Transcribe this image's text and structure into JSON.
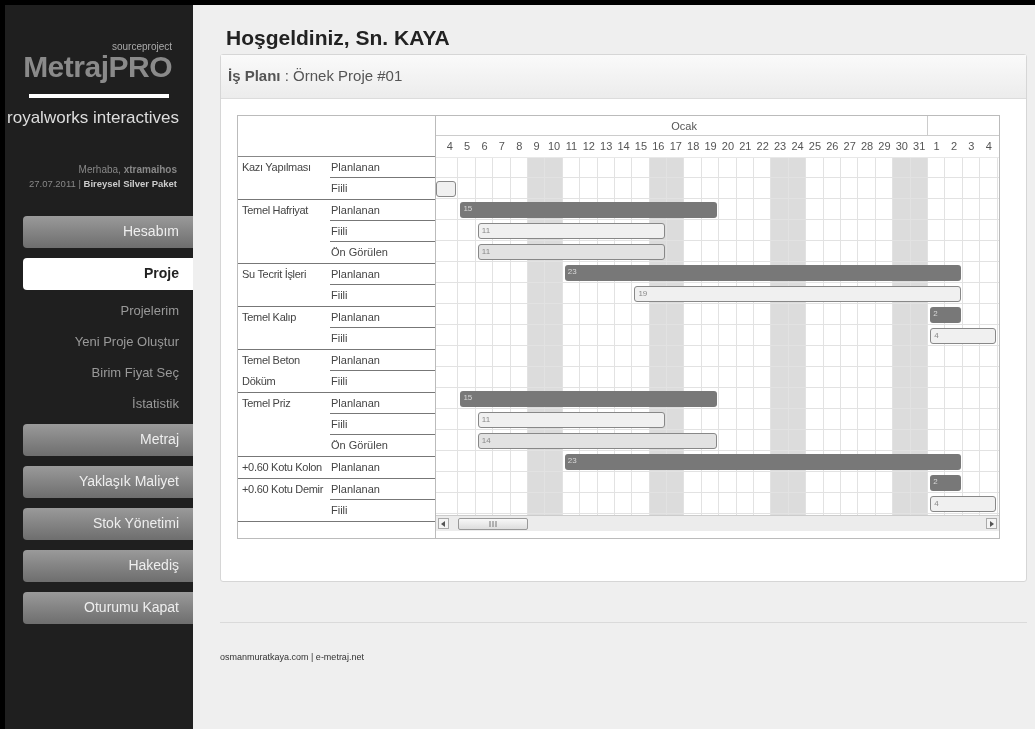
{
  "sidebar": {
    "logo_top": "sourceproject",
    "logo": "MetrajPRO",
    "tagline": "royalworks interactives",
    "greeting": "Merhaba, **xtramaihos**",
    "account": "27.07.2011 | **Bireysel Silver Paket**",
    "items": [
      {
        "label": "Hesabım",
        "kind": "section",
        "selected": false
      },
      {
        "label": "Proje",
        "kind": "section",
        "selected": true
      },
      {
        "label": "Projelerim",
        "kind": "link",
        "selected": false
      },
      {
        "label": "Yeni Proje Oluştur",
        "kind": "link",
        "selected": false
      },
      {
        "label": "Birim Fiyat Seç",
        "kind": "link",
        "selected": false
      },
      {
        "label": "İstatistik",
        "kind": "link",
        "selected": false
      },
      {
        "label": "Metraj",
        "kind": "section",
        "selected": false
      },
      {
        "label": "Yaklaşık Maliyet",
        "kind": "section",
        "selected": false
      },
      {
        "label": "Stok Yönetimi",
        "kind": "section",
        "selected": false
      },
      {
        "label": "Hakediş",
        "kind": "section",
        "selected": false
      },
      {
        "label": "Oturumu Kapat",
        "kind": "section",
        "selected": false
      }
    ]
  },
  "page_title": "Hoşgeldiniz, Sn. KAYA",
  "card": {
    "title": "**İş Planı** : Örnek Proje #01",
    "gantt": {
      "months": [
        {
          "label": "Ocak",
          "days": [
            {
              "label": "4",
              "weekend": false
            },
            {
              "label": "5",
              "weekend": false
            },
            {
              "label": "6",
              "weekend": false
            },
            {
              "label": "7",
              "weekend": false
            },
            {
              "label": "8",
              "weekend": false
            },
            {
              "label": "9",
              "weekend": true
            },
            {
              "label": "10",
              "weekend": true
            },
            {
              "label": "11",
              "weekend": false
            },
            {
              "label": "12",
              "weekend": false
            },
            {
              "label": "13",
              "weekend": false
            },
            {
              "label": "14",
              "weekend": false
            },
            {
              "label": "15",
              "weekend": false
            },
            {
              "label": "16",
              "weekend": true
            },
            {
              "label": "17",
              "weekend": true
            },
            {
              "label": "18",
              "weekend": false
            },
            {
              "label": "19",
              "weekend": false
            },
            {
              "label": "20",
              "weekend": false
            },
            {
              "label": "21",
              "weekend": false
            },
            {
              "label": "22",
              "weekend": false
            },
            {
              "label": "23",
              "weekend": true
            },
            {
              "label": "24",
              "weekend": true
            },
            {
              "label": "25",
              "weekend": false
            },
            {
              "label": "26",
              "weekend": false
            },
            {
              "label": "27",
              "weekend": false
            },
            {
              "label": "28",
              "weekend": false
            },
            {
              "label": "29",
              "weekend": false
            },
            {
              "label": "30",
              "weekend": true
            },
            {
              "label": "31",
              "weekend": true
            }
          ]
        },
        {
          "days": [
            {
              "label": "1",
              "weekend": false
            },
            {
              "label": "2",
              "weekend": false
            },
            {
              "label": "3",
              "weekend": false
            },
            {
              "label": "4",
              "weekend": false
            }
          ]
        }
      ],
      "tasks": [
        {
          "name": "Kazı Yapılması",
          "rows": [
            {
              "type": "Planlanan"
            },
            {
              "type": "Fiili",
              "bar": {
                "kind": "actual"
              }
            }
          ]
        },
        {
          "name": "Temel Hafriyat",
          "rows": [
            {
              "type": "Planlanan",
              "bar": {
                "kind": "planned",
                "label": "15"
              }
            },
            {
              "type": "Fiili",
              "bar": {
                "kind": "actual",
                "label": "11"
              }
            },
            {
              "type": "Ön Görülen",
              "bar": {
                "kind": "forecast",
                "label": "11"
              }
            }
          ]
        },
        {
          "name": "Su Tecrit İşleri",
          "rows": [
            {
              "type": "Planlanan",
              "bar": {
                "kind": "planned",
                "label": "23"
              }
            },
            {
              "type": "Fiili",
              "bar": {
                "kind": "actual",
                "label": "19"
              }
            }
          ]
        },
        {
          "name": "Temel Kalıp",
          "rows": [
            {
              "type": "Planlanan",
              "bar": {
                "kind": "planned",
                "label": "2"
              }
            },
            {
              "type": "Fiili",
              "bar": {
                "kind": "actual",
                "label": "4"
              }
            }
          ]
        },
        {
          "name": "Temel Beton Döküm",
          "rows": [
            {
              "type": "Planlanan"
            },
            {
              "type": "Fiili"
            }
          ]
        },
        {
          "name": "Temel Priz",
          "rows": [
            {
              "type": "Planlanan",
              "bar": {
                "kind": "planned",
                "label": "15"
              }
            },
            {
              "type": "Fiili",
              "bar": {
                "kind": "actual",
                "label": "11"
              }
            },
            {
              "type": "Ön Görülen",
              "bar": {
                "kind": "forecast",
                "label": "14"
              }
            }
          ]
        },
        {
          "name": "+0.60 Kotu Kolon",
          "rows": [
            {
              "type": "Planlanan",
              "bar": {
                "kind": "planned",
                "label": "23"
              }
            }
          ]
        },
        {
          "name": "+0.60 Kotu Demir",
          "rows": [
            {
              "type": "Planlanan",
              "bar": {
                "kind": "planned",
                "label": "2"
              }
            },
            {
              "type": "Fiili",
              "bar": {
                "kind": "actual",
                "label": "4"
              }
            }
          ]
        }
      ]
    }
  },
  "footer": "osmanmuratkaya.com | e-metraj.net"
}
